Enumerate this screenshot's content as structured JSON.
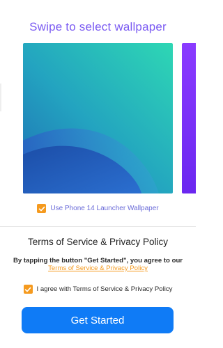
{
  "header": {
    "title": "Swipe to select wallpaper"
  },
  "wallpaper": {
    "use_label": "Use Phone 14 Launcher Wallpaper",
    "use_checked": true,
    "colors": {
      "teal": "#27d4b8",
      "blue": "#1b4aa5",
      "next_purple": "#7b32ff"
    }
  },
  "policy": {
    "title": "Terms of Service & Privacy Policy",
    "text": "By tapping the button \"Get Started\", you agree to our",
    "link_text": "Terms of Service & Privacy Policy",
    "agree_label": "I agree with Terms of Service & Privacy Policy",
    "agree_checked": true
  },
  "cta": {
    "label": "Get Started"
  },
  "colors": {
    "accent": "#7a5af2",
    "orange": "#f59a1e",
    "button": "#0f7bf6"
  }
}
